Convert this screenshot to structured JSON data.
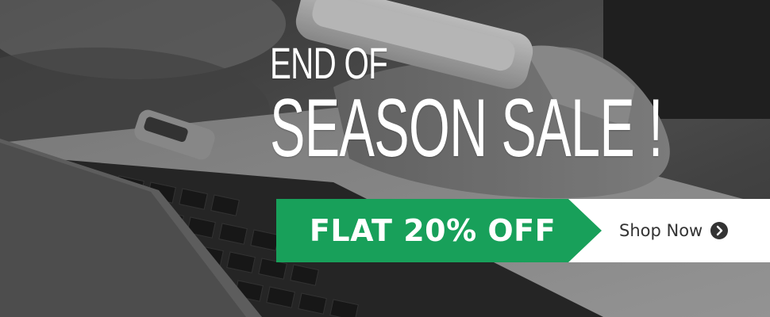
{
  "banner": {
    "headline_line1": "END OF",
    "headline_line2": "SEASON SALE !",
    "offer_text": "FLAT 20% OFF",
    "cta_label": "Shop Now",
    "cta_icon": "chevron-right-circle-icon"
  },
  "colors": {
    "offer_green": "#18a05a",
    "headline_white": "#ffffff",
    "cta_text": "#333333",
    "strip_white": "#ffffff"
  }
}
